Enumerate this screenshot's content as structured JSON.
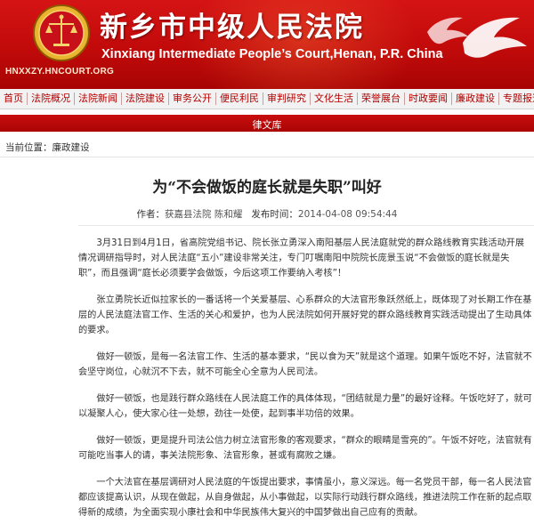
{
  "header": {
    "cn_title": "新乡市中级人民法院",
    "en_title": "Xinxiang Intermediate People’s Court,Henan, P.R. China",
    "url": "HNXXZY.HNCOURT.ORG",
    "brand_color": "#c10a0a"
  },
  "nav": {
    "items": [
      "首页",
      "法院概况",
      "法院新闻",
      "法院建设",
      "审务公开",
      "便民利民",
      "审判研究",
      "文化生活",
      "荣誉展台",
      "时政要闻",
      "廉政建设",
      "专题报道"
    ]
  },
  "subnav": {
    "label": "律文库"
  },
  "breadcrumb": {
    "label": "当前位置：",
    "current": "廉政建设"
  },
  "article": {
    "title": "为“不会做饭的庭长就是失职”叫好",
    "author_label": "作者：",
    "author": "获嘉县法院 陈和耀",
    "date_label": "发布时间：",
    "date": "2014-04-08 09:54:44",
    "paragraphs": [
      "3月31日到4月1日，省高院党组书记、院长张立勇深入南阳基层人民法庭就党的群众路线教育实践活动开展情况调研指导时，对人民法庭“五小”建设非常关注，专门叮嘱南阳中院院长庞景玉说“不会做饭的庭长就是失职”，而且强调“庭长必须要学会做饭，今后这项工作要纳入考核”！",
      "张立勇院长近似拉家长的一番话将一个关爱基层、心系群众的大法官形象跃然纸上，既体现了对长期工作在基层的人民法庭法官工作、生活的关心和爱护，也为人民法院如何开展好党的群众路线教育实践活动提出了生动具体的要求。",
      "做好一顿饭，是每一名法官工作、生活的基本要求，“民以食为天”就是这个道理。如果午饭吃不好，法官就不会坚守岗位，心就沉不下去，就不可能全心全意为人民司法。",
      "做好一顿饭，也是践行群众路线在人民法庭工作的具体体现，“团结就是力量”的最好诠释。午饭吃好了，就可以凝聚人心，使大家心往一处想，劲往一处使，起到事半功倍的效果。",
      "做好一顿饭，更是提升司法公信力树立法官形象的客观要求，“群众的眼睛是雪亮的”。午饭不好吃，法官就有可能吃当事人的请，事关法院形象、法官形象，甚或有腐败之嫌。",
      "一个大法官在基层调研对人民法庭的午饭提出要求，事情虽小，意义深远。每一名党员干部，每一名人民法官都应该提高认识，从现在做起，从自身做起，从小事做起，以实际行动践行群众路线，推进法院工作在新的起点取得新的成绩，为全面实现小康社会和中华民族伟大复兴的中国梦做出自己应有的贡献。"
    ]
  }
}
